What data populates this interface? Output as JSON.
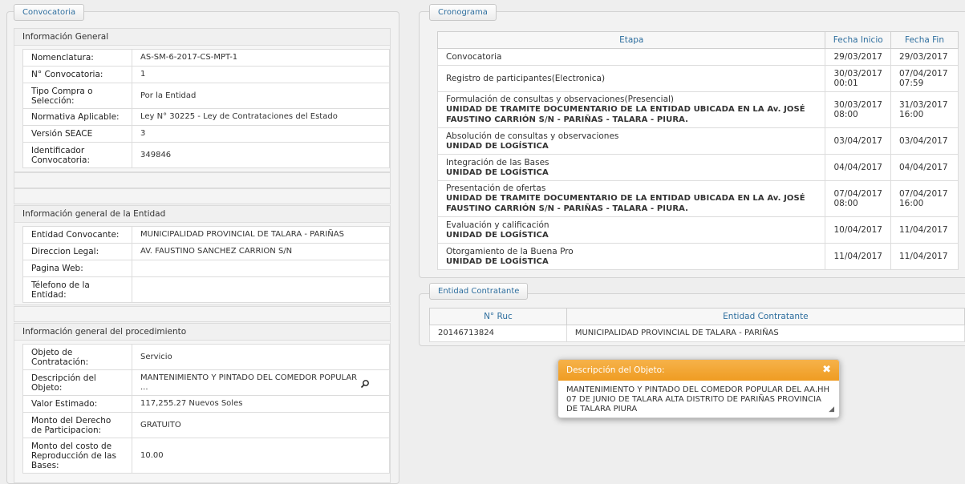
{
  "left_panel": {
    "tab": "Convocatoria",
    "general": {
      "title": "Información General",
      "rows": [
        {
          "label": "Nomenclatura:",
          "value": "AS-SM-6-2017-CS-MPT-1"
        },
        {
          "label": "N° Convocatoria:",
          "value": "1"
        },
        {
          "label": "Tipo Compra o Selección:",
          "value": "Por la Entidad"
        },
        {
          "label": "Normativa Aplicable:",
          "value": "Ley N° 30225 - Ley de Contrataciones del Estado"
        },
        {
          "label": "Versión SEACE",
          "value": "3"
        },
        {
          "label": "Identificador Convocatoria:",
          "value": "349846"
        }
      ]
    },
    "entidad": {
      "title": "Información general de la Entidad",
      "rows": [
        {
          "label": "Entidad Convocante:",
          "value": "MUNICIPALIDAD PROVINCIAL DE TALARA - PARIÑAS"
        },
        {
          "label": "Direccion Legal:",
          "value": "AV. FAUSTINO SANCHEZ CARRION S/N"
        },
        {
          "label": "Pagina Web:",
          "value": ""
        },
        {
          "label": "Télefono de la Entidad:",
          "value": ""
        }
      ]
    },
    "procedimiento": {
      "title": "Información general del procedimiento",
      "rows": [
        {
          "label": "Objeto de Contratación:",
          "value": "Servicio"
        },
        {
          "label": "Descripción del Objeto:",
          "value": "MANTENIMIENTO Y PINTADO DEL COMEDOR POPULAR ..."
        },
        {
          "label": "Valor Estimado:",
          "value": "117,255.27  Nuevos Soles"
        },
        {
          "label": "Monto del Derecho de Participacion:",
          "value": "GRATUITO"
        },
        {
          "label": "Monto del costo de Reproducción de las Bases:",
          "value": "10.00"
        }
      ]
    }
  },
  "cronograma": {
    "tab": "Cronograma",
    "headers": [
      "Etapa",
      "Fecha Inicio",
      "Fecha Fin"
    ],
    "rows": [
      {
        "etapa": "Convocatoria",
        "lugar": "",
        "inicio": "29/03/2017",
        "inicio_hora": "",
        "fin": "29/03/2017",
        "fin_hora": ""
      },
      {
        "etapa": "Registro de participantes(Electronica)",
        "lugar": "",
        "inicio": "30/03/2017",
        "inicio_hora": "00:01",
        "fin": "07/04/2017",
        "fin_hora": "07:59"
      },
      {
        "etapa": "Formulación de consultas y observaciones(Presencial)",
        "lugar": "UNIDAD DE TRAMITE DOCUMENTARIO DE LA ENTIDAD UBICADA EN LA Av. JOSÉ FAUSTINO CARRIÓN S/N - PARIÑAS - TALARA - PIURA.",
        "inicio": "30/03/2017",
        "inicio_hora": "08:00",
        "fin": "31/03/2017",
        "fin_hora": "16:00"
      },
      {
        "etapa": "Absolución de consultas y observaciones",
        "lugar": "UNIDAD DE LOGÍSTICA",
        "inicio": "03/04/2017",
        "inicio_hora": "",
        "fin": "03/04/2017",
        "fin_hora": ""
      },
      {
        "etapa": "Integración de las Bases",
        "lugar": "UNIDAD DE LOGÍSTICA",
        "inicio": "04/04/2017",
        "inicio_hora": "",
        "fin": "04/04/2017",
        "fin_hora": ""
      },
      {
        "etapa": "Presentación de ofertas",
        "lugar": "UNIDAD DE TRAMITE DOCUMENTARIO DE LA ENTIDAD UBICADA EN LA Av. JOSÉ FAUSTINO CARRIÓN S/N - PARIÑAS - TALARA - PIURA.",
        "inicio": "07/04/2017",
        "inicio_hora": "08:00",
        "fin": "07/04/2017",
        "fin_hora": "16:00"
      },
      {
        "etapa": "Evaluación y calificación",
        "lugar": "UNIDAD DE LOGÍSTICA",
        "inicio": "10/04/2017",
        "inicio_hora": "",
        "fin": "11/04/2017",
        "fin_hora": ""
      },
      {
        "etapa": "Otorgamiento de la Buena Pro",
        "lugar": "UNIDAD DE LOGÍSTICA",
        "inicio": "11/04/2017",
        "inicio_hora": "",
        "fin": "11/04/2017",
        "fin_hora": ""
      }
    ]
  },
  "contratante": {
    "tab": "Entidad Contratante",
    "headers": [
      "N° Ruc",
      "Entidad Contratante"
    ],
    "rows": [
      {
        "ruc": "20146713824",
        "entidad": "MUNICIPALIDAD PROVINCIAL DE TALARA - PARIÑAS"
      }
    ]
  },
  "dialog": {
    "title": "Descripción del Objeto:",
    "close": "✖",
    "body": "MANTENIMIENTO Y PINTADO DEL COMEDOR POPULAR DEL AA.HH 07 DE JUNIO DE TALARA ALTA DISTRITO DE PARIÑAS PROVINCIA DE TALARA PIURA"
  },
  "icons": {
    "magnifier": "magnifier-icon",
    "close": "close-icon",
    "resize": "resize-grip-icon"
  }
}
